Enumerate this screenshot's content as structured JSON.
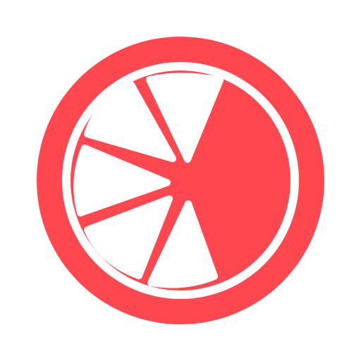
{
  "app": {
    "icon_name": "citrus-slice-icon",
    "colors": {
      "accent": "#FF474F",
      "background": "#FFFFFF",
      "segment": "#FFFFFF"
    }
  }
}
